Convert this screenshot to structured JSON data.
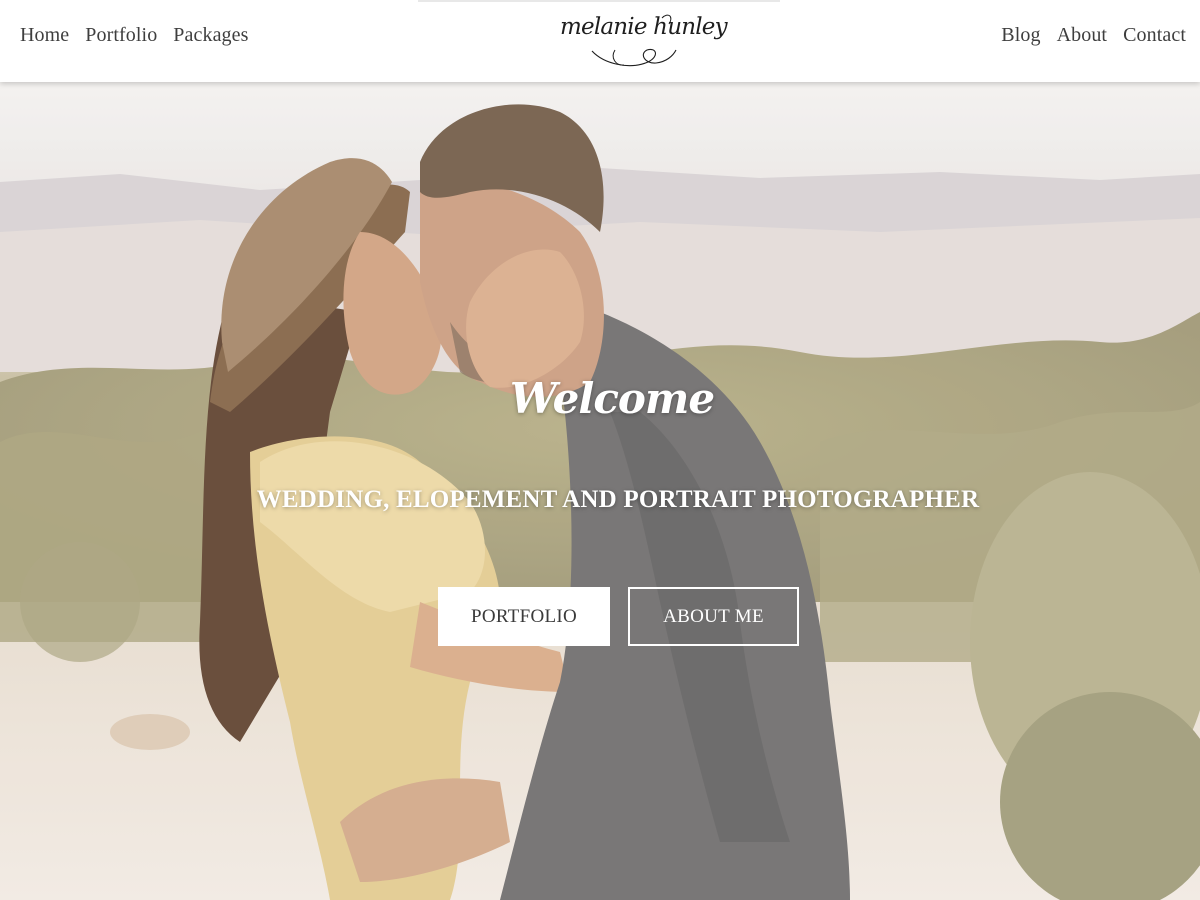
{
  "header": {
    "nav_left": [
      "Home",
      "Portfolio",
      "Packages"
    ],
    "nav_right": [
      "Blog",
      "About",
      "Contact"
    ],
    "logo_text": "melanie hunley"
  },
  "hero": {
    "title": "Welcome",
    "subtitle": "WEDDING, ELOPEMENT AND PORTRAIT PHOTOGRAPHER",
    "buttons": {
      "portfolio": "PORTFOLIO",
      "about": "ABOUT ME"
    }
  },
  "colors": {
    "header_bg": "#ffffff",
    "nav_text": "#3e3e3e",
    "hero_text": "#ffffff",
    "primary_button_bg": "#ffffff",
    "primary_button_text": "#3a3a3a"
  },
  "icons": [
    "logo-flourish-icon"
  ]
}
